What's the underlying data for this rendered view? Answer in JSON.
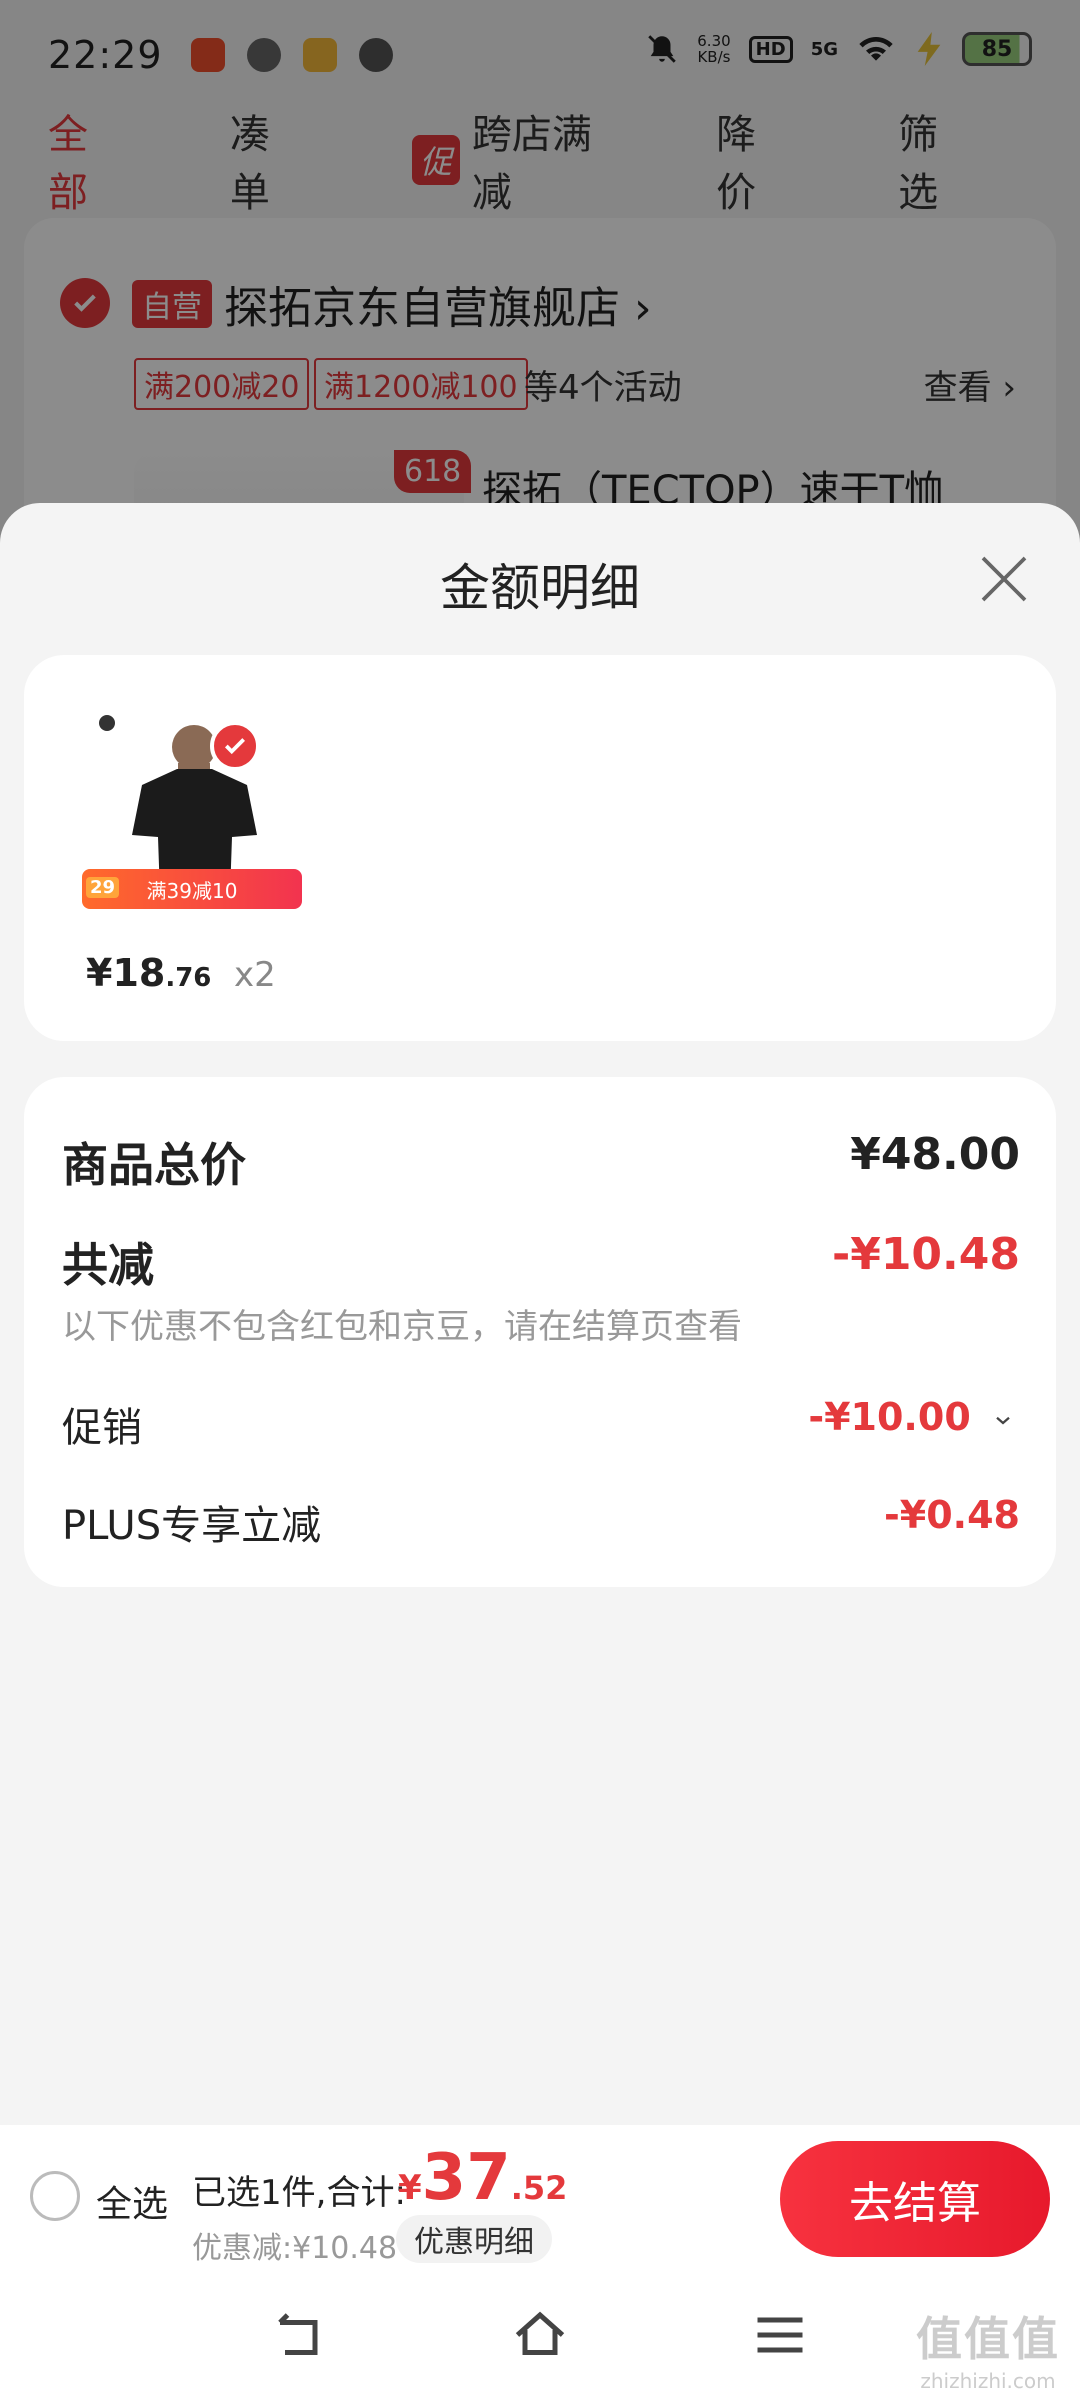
{
  "status_bar": {
    "time": "22:29",
    "net_speed": "6.30",
    "net_unit": "KB/s",
    "hd": "HD",
    "signal": "5G",
    "battery": "85"
  },
  "tabs": [
    {
      "label": "全部"
    },
    {
      "label": "凑单"
    },
    {
      "label": "跨店满减",
      "tag": "促"
    },
    {
      "label": "降价"
    },
    {
      "label": "筛选"
    }
  ],
  "store": {
    "tag": "自营",
    "name": "探拓京东自营旗舰店",
    "coupons": [
      "满200减20",
      "满1200减100"
    ],
    "activities": "等4个活动",
    "view": "查看",
    "badge": "618",
    "product_title": "探拓（TECTOP）速干T恤"
  },
  "sheet": {
    "title": "金额明细",
    "item": {
      "price_int": "¥18",
      "price_dec": ".76",
      "qty": "x2",
      "strip_num": "29",
      "strip_text": "满39减10",
      "brand": "TECTOP"
    },
    "summary": {
      "total_label": "商品总价",
      "total_value": "¥48.00",
      "reduce_label": "共减",
      "reduce_value": "-¥10.48",
      "note": "以下优惠不包含红包和京豆，请在结算页查看",
      "promo_label": "促销",
      "promo_value": "-¥10.00",
      "plus_label": "PLUS专享立减",
      "plus_value": "-¥0.48"
    }
  },
  "bottom_bar": {
    "select_all": "全选",
    "selected": "已选1件,合计:",
    "currency": "¥",
    "total_int": "37",
    "total_dec": ".52",
    "discount": "优惠减:¥10.48",
    "detail_chip": "优惠明细",
    "checkout": "去结算"
  },
  "watermark": {
    "top": "值值值",
    "bottom": "zhizhizhi.com"
  },
  "colors": {
    "accent": "#e4393c",
    "muted": "#999999"
  }
}
